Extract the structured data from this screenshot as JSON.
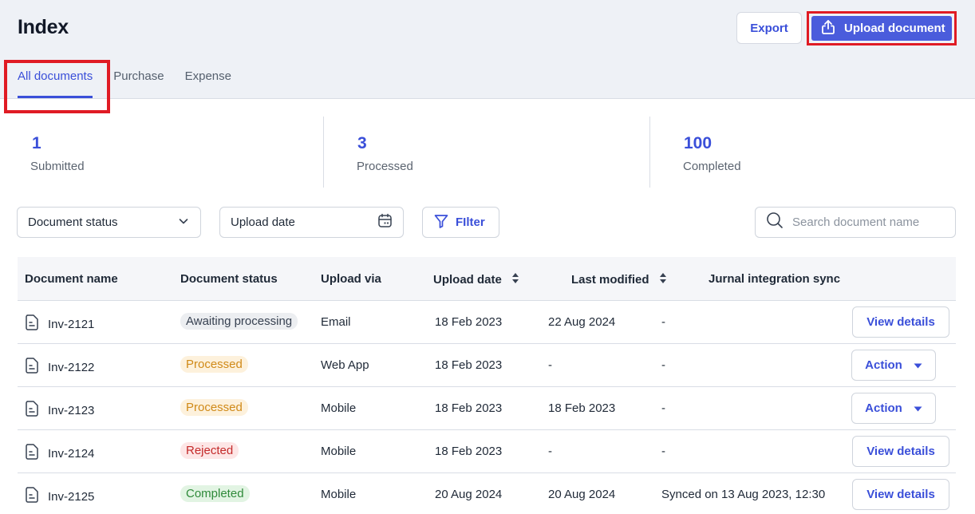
{
  "header": {
    "title": "Index",
    "export_label": "Export",
    "upload_label": "Upload document"
  },
  "tabs": [
    {
      "label": "All documents",
      "active": true
    },
    {
      "label": "Purchase",
      "active": false
    },
    {
      "label": "Expense",
      "active": false
    }
  ],
  "stats": [
    {
      "value": "1",
      "label": "Submitted"
    },
    {
      "value": "3",
      "label": "Processed"
    },
    {
      "value": "100",
      "label": "Completed"
    }
  ],
  "filters": {
    "status_label": "Document status",
    "date_label": "Upload date",
    "filter_label": "FIlter",
    "search_placeholder": "Search document name"
  },
  "table": {
    "columns": [
      "Document name",
      "Document status",
      "Upload via",
      "Upload date",
      "Last modified",
      "Jurnal integration sync"
    ],
    "rows": [
      {
        "name": "Inv-2121",
        "status": "Awaiting processing",
        "status_kind": "await",
        "via": "Email",
        "upload_date": "18 Feb 2023",
        "last_modified": "22 Aug 2024",
        "sync": "-",
        "action": "View details"
      },
      {
        "name": "Inv-2122",
        "status": "Processed",
        "status_kind": "processed",
        "via": "Web App",
        "upload_date": "18 Feb 2023",
        "last_modified": "-",
        "sync": "-",
        "action": "Action"
      },
      {
        "name": "Inv-2123",
        "status": "Processed",
        "status_kind": "processed",
        "via": "Mobile",
        "upload_date": "18 Feb 2023",
        "last_modified": "18 Feb 2023",
        "sync": "-",
        "action": "Action"
      },
      {
        "name": "Inv-2124",
        "status": "Rejected",
        "status_kind": "rejected",
        "via": "Mobile",
        "upload_date": "18 Feb 2023",
        "last_modified": "-",
        "sync": "-",
        "action": "View details"
      },
      {
        "name": "Inv-2125",
        "status": "Completed",
        "status_kind": "completed",
        "via": "Mobile",
        "upload_date": "20 Aug 2024",
        "last_modified": "20 Aug 2024",
        "sync": "Synced on 13 Aug 2023, 12:30",
        "action": "View details"
      }
    ]
  },
  "colors": {
    "accent": "#3a4fd9",
    "primary_button": "#4a5cdc",
    "highlight_box": "#e01b24"
  }
}
